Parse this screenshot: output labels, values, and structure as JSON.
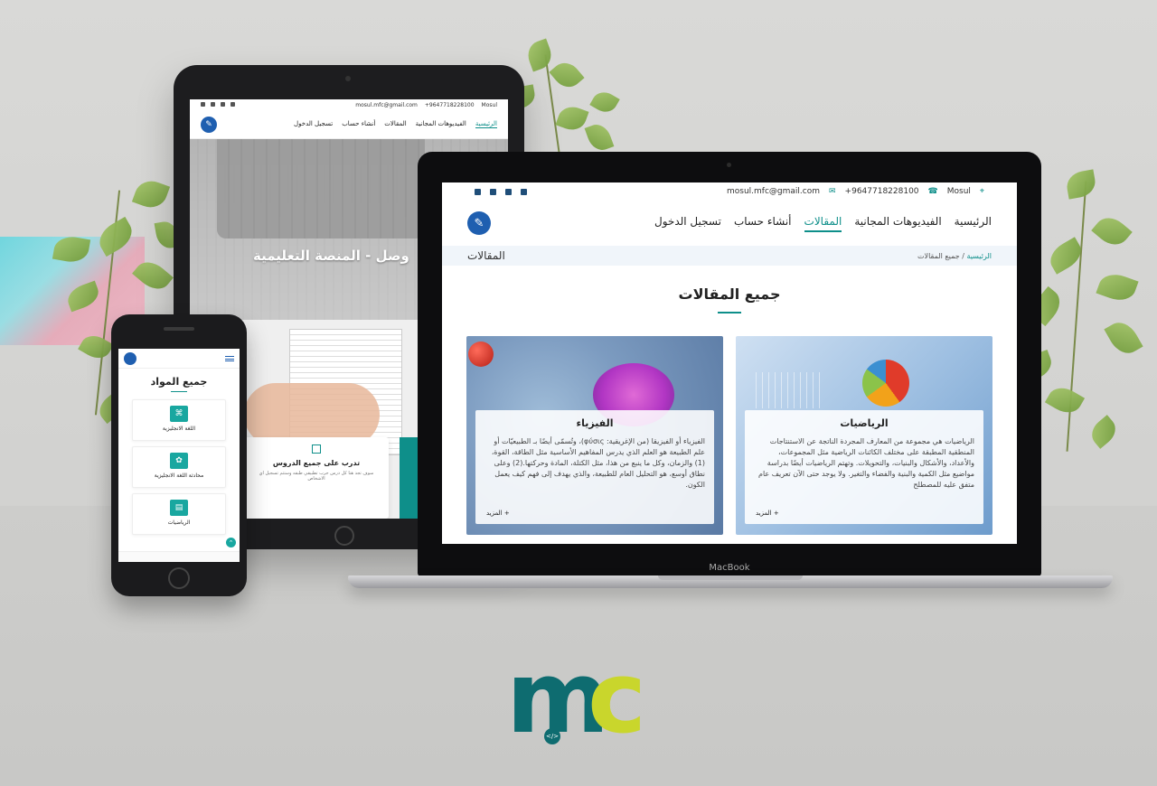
{
  "laptop": {
    "brand_label": "MacBook",
    "topbar": {
      "location": "Mosul",
      "phone": "+9647718228100",
      "email": "mosul.mfc@gmail.com",
      "social_icons": [
        "linkedin-icon",
        "email-icon",
        "telegram-icon",
        "facebook-icon"
      ]
    },
    "nav": {
      "logo_icon": "academy-logo-icon",
      "links": [
        {
          "label": "الرئيسية",
          "active": false
        },
        {
          "label": "الفيديوهات المجانية",
          "active": false
        },
        {
          "label": "المقالات",
          "active": true
        },
        {
          "label": "أنشاء حساب",
          "active": false
        },
        {
          "label": "تسجيل الدخول",
          "active": false
        }
      ]
    },
    "crumbbar": {
      "page_title": "المقالات",
      "home": "الرئيسية",
      "separator": "/",
      "current": "جميع المقالات"
    },
    "heading": "جميع المقالات",
    "cards": [
      {
        "id": "math",
        "title": "الرياضيات",
        "text": "الرياضيات هي مجموعة من المعارف المجردة الناتجة عن الاستنتاجات المنطقية المطبقة على مختلف الكائنات الرياضية مثل المجموعات، والأعداد، والأشكال والبنيات، والتحويلات. وتهتم الرياضيات أيضًا بدراسة مواضيع مثل الكمية والبنية والفضاء والتغير. ولا يوجد حتى الآن تعريف عام متفق عليه للمصطلح",
        "more": "+ المزيد"
      },
      {
        "id": "physics",
        "title": "الفيزياء",
        "text": "الفيزياء أو الفيزيقا (من الإغريقية: φύσις)، وتُسمّى أيضًا بـ الطبيعيّات أو علم الطبيعة هو العلم الذي يدرس المفاهيم الأساسية مثل الطاقة، القوة،(1) والزمان، وكل ما ينبع من هذا، مثل الكتلة، المادة وحركتها.(2) وعلى نطاق أوسع، هو التحليل العام للطبيعة، والذي يهدف إلى فهم كيف يعمل الكون.",
        "more": "+ المزيد"
      }
    ]
  },
  "tablet": {
    "topbar": {
      "location": "Mosul",
      "phone": "+9647718228100",
      "email": "mosul.mfc@gmail.com"
    },
    "nav_links": [
      "الرئيسية",
      "الفيديوهات المجانية",
      "المقالات",
      "أنشاء حساب",
      "تسجيل الدخول"
    ],
    "hero_title": "وصل - المنصة التعليمية",
    "card": {
      "title": "تدرب على جميع الدروس",
      "sub": "سوف تجد هنا كل درس جرب تطبيقي طبقه وستتم تسجيل اي الاشخاص"
    }
  },
  "phone": {
    "title": "جميع المواد",
    "cards": [
      {
        "label": "اللغة الانجليزية",
        "icon": "language-icon"
      },
      {
        "label": "محادثة اللغة الانجليزية",
        "icon": "chat-icon"
      },
      {
        "label": "الرياضيات",
        "icon": "math-icon"
      }
    ]
  },
  "brand_logo": {
    "letters": "mc",
    "colors": {
      "m": "#0e6c70",
      "c": "#c9d62c"
    }
  },
  "colors": {
    "accent": "#0e8f8a",
    "logo_blue": "#1f5fb0"
  }
}
